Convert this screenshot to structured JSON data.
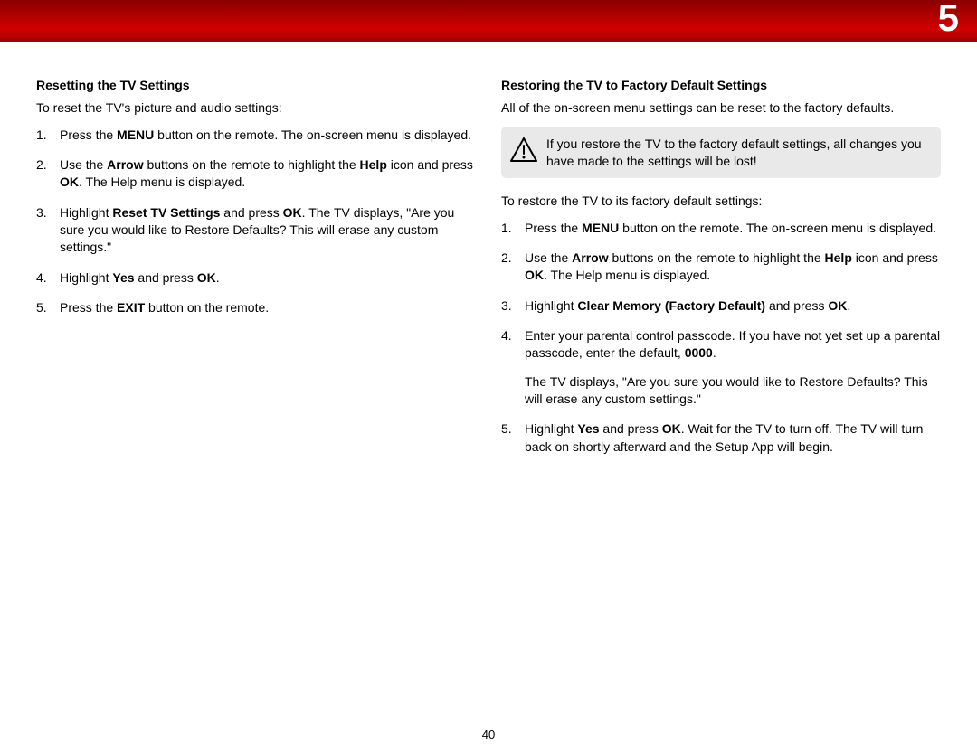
{
  "chapter_number": "5",
  "page_number": "40",
  "left": {
    "heading": "Resetting the TV Settings",
    "intro": "To reset the TV's picture and audio settings:",
    "steps": [
      {
        "prefix": "Press the ",
        "b1": "MENU",
        "mid": " button on the remote. The on-screen menu is displayed.",
        "b2": "",
        "suffix": ""
      },
      {
        "prefix": "Use the ",
        "b1": "Arrow",
        "mid": " buttons on the remote to highlight the ",
        "b2": "Help",
        "suffix_a": " icon and press ",
        "b3": "OK",
        "suffix_b": ". The Help menu is displayed."
      },
      {
        "prefix": "Highlight ",
        "b1": "Reset TV Settings",
        "mid": " and press ",
        "b2": "OK",
        "suffix": ". The TV displays, \"Are you sure you would like to Restore Defaults? This will erase any custom settings.\""
      },
      {
        "prefix": "Highlight ",
        "b1": "Yes",
        "mid": " and press ",
        "b2": "OK",
        "suffix": "."
      },
      {
        "prefix": "Press the ",
        "b1": "EXIT",
        "mid": " button on the remote.",
        "b2": "",
        "suffix": ""
      }
    ]
  },
  "right": {
    "heading": "Restoring the TV to Factory Default Settings",
    "intro": "All of the on-screen menu settings can be reset to the factory defaults.",
    "warning": "If you restore the TV to the factory default settings, all changes you have made to the settings will be lost!",
    "lead": "To restore the TV to its factory default settings:",
    "steps": [
      {
        "prefix": "Press the ",
        "b1": "MENU",
        "mid": " button on the remote. The on-screen menu is displayed."
      },
      {
        "prefix": "Use the ",
        "b1": "Arrow",
        "mid": " buttons on the remote to highlight the ",
        "b2": "Help",
        "suffix_a": " icon and press ",
        "b3": "OK",
        "suffix_b": ". The Help menu is displayed."
      },
      {
        "prefix": "Highlight ",
        "b1": "Clear Memory (Factory Default)",
        "mid": " and press ",
        "b2": "OK",
        "suffix": "."
      },
      {
        "prefix": "Enter your parental control passcode. If you have not yet set up a parental passcode, enter the default, ",
        "b1": "0000",
        "mid": ".",
        "sub": "The TV displays, \"Are you sure you would like to Restore Defaults? This will erase any custom settings.\""
      },
      {
        "prefix": "Highlight ",
        "b1": "Yes",
        "mid": " and press ",
        "b2": "OK",
        "suffix": ". Wait for the TV to turn off. The TV will turn back on shortly afterward and the Setup App will begin."
      }
    ]
  }
}
